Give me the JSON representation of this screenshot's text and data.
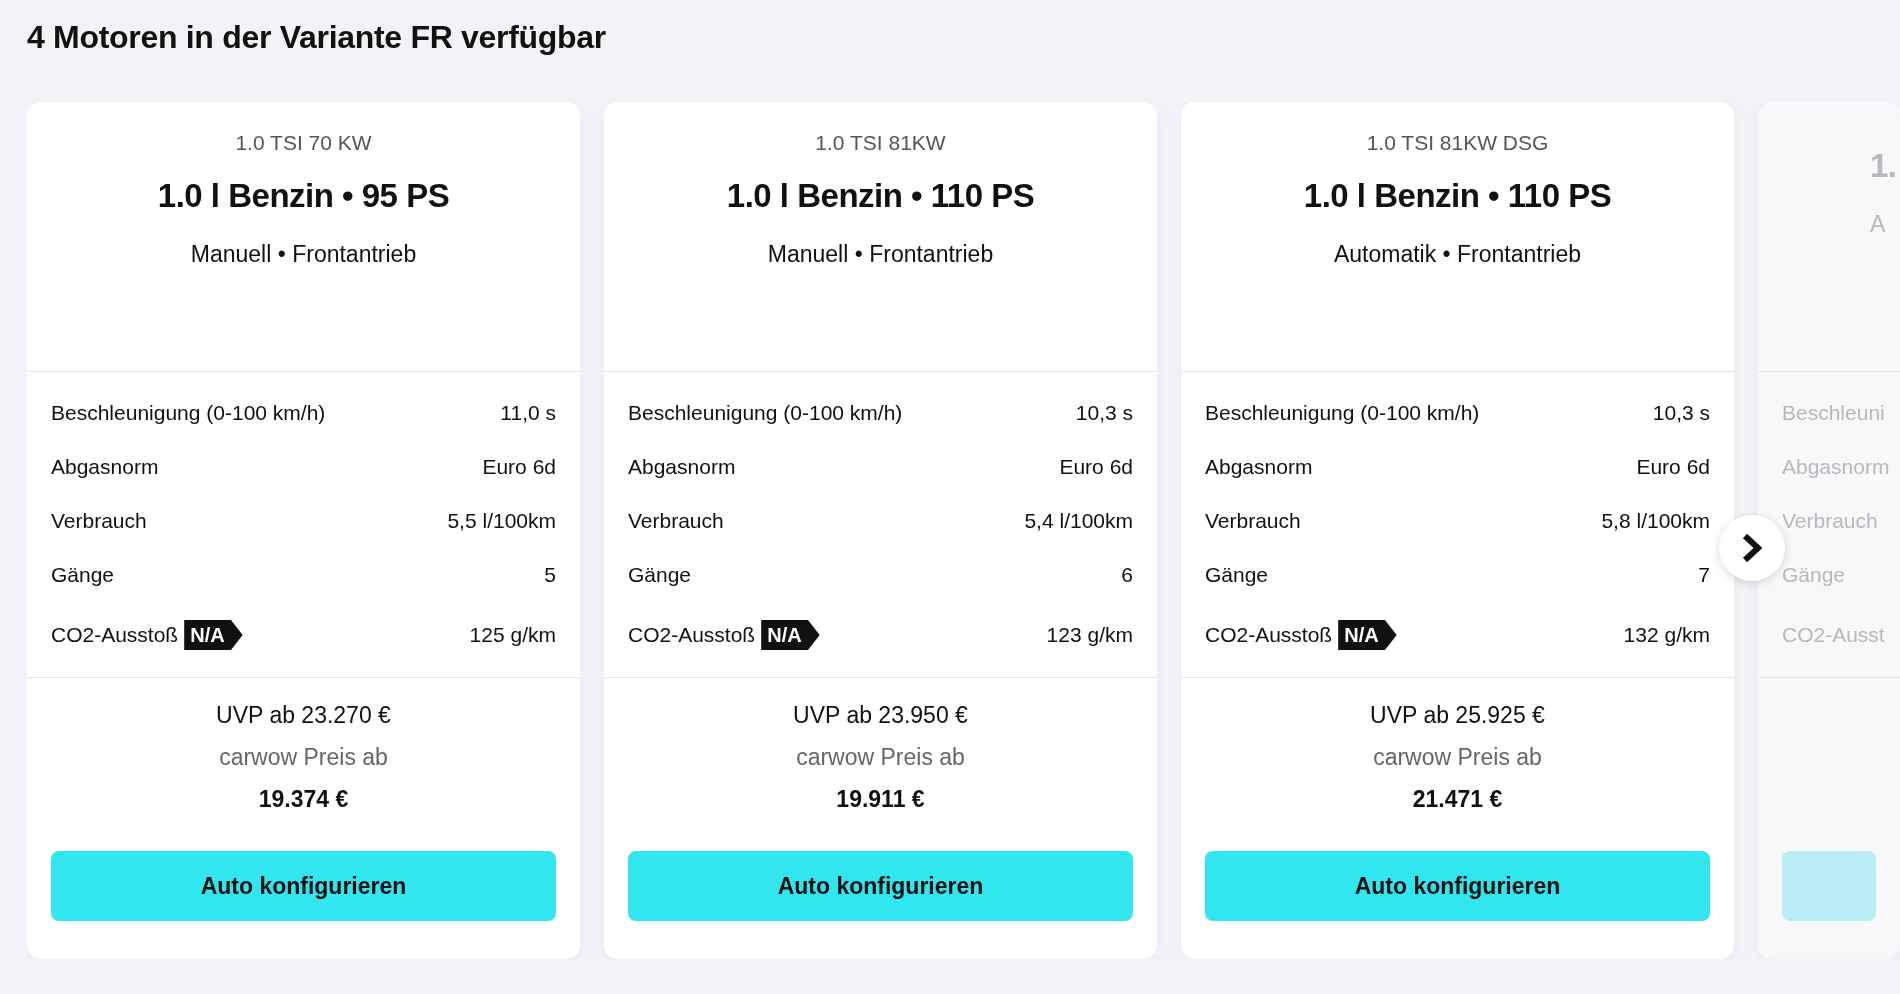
{
  "heading": "4 Motoren in der Variante FR verfügbar",
  "cards": [
    {
      "faded": false,
      "engine_code": "1.0 TSI 70 KW",
      "headline": "1.0 l Benzin • 95 PS",
      "drivetrain": "Manuell • Frontantrieb",
      "specs": [
        {
          "label": "Beschleunigung (0-100 km/h)",
          "value": "11,0 s"
        },
        {
          "label": "Abgasnorm",
          "value": "Euro 6d"
        },
        {
          "label": "Verbrauch",
          "value": "5,5 l/100km"
        },
        {
          "label": "Gänge",
          "value": "5"
        },
        {
          "label": "CO2-Ausstoß",
          "tag": "N/A",
          "value": "125 g/km"
        }
      ],
      "uvp": "UVP ab 23.270 €",
      "price_label": "carwow Preis ab",
      "price": "19.374 €",
      "button": "Auto konfigurieren"
    },
    {
      "faded": false,
      "engine_code": "1.0 TSI 81KW",
      "headline": "1.0 l Benzin • 110 PS",
      "drivetrain": "Manuell • Frontantrieb",
      "specs": [
        {
          "label": "Beschleunigung (0-100 km/h)",
          "value": "10,3 s"
        },
        {
          "label": "Abgasnorm",
          "value": "Euro 6d"
        },
        {
          "label": "Verbrauch",
          "value": "5,4 l/100km"
        },
        {
          "label": "Gänge",
          "value": "6"
        },
        {
          "label": "CO2-Ausstoß",
          "tag": "N/A",
          "value": "123 g/km"
        }
      ],
      "uvp": "UVP ab 23.950 €",
      "price_label": "carwow Preis ab",
      "price": "19.911 €",
      "button": "Auto konfigurieren"
    },
    {
      "faded": false,
      "engine_code": "1.0 TSI 81KW DSG",
      "headline": "1.0 l Benzin • 110 PS",
      "drivetrain": "Automatik • Frontantrieb",
      "specs": [
        {
          "label": "Beschleunigung (0-100 km/h)",
          "value": "10,3 s"
        },
        {
          "label": "Abgasnorm",
          "value": "Euro 6d"
        },
        {
          "label": "Verbrauch",
          "value": "5,8 l/100km"
        },
        {
          "label": "Gänge",
          "value": "7"
        },
        {
          "label": "CO2-Ausstoß",
          "tag": "N/A",
          "value": "132 g/km"
        }
      ],
      "uvp": "UVP ab 25.925 €",
      "price_label": "carwow Preis ab",
      "price": "21.471 €",
      "button": "Auto konfigurieren"
    },
    {
      "faded": true,
      "headline": "1.",
      "drivetrain": "A",
      "specs": [
        {
          "label": "Beschleuni"
        },
        {
          "label": "Abgasnorm"
        },
        {
          "label": "Verbrauch"
        },
        {
          "label": "Gänge"
        },
        {
          "label": "CO2-Ausst"
        }
      ]
    }
  ]
}
